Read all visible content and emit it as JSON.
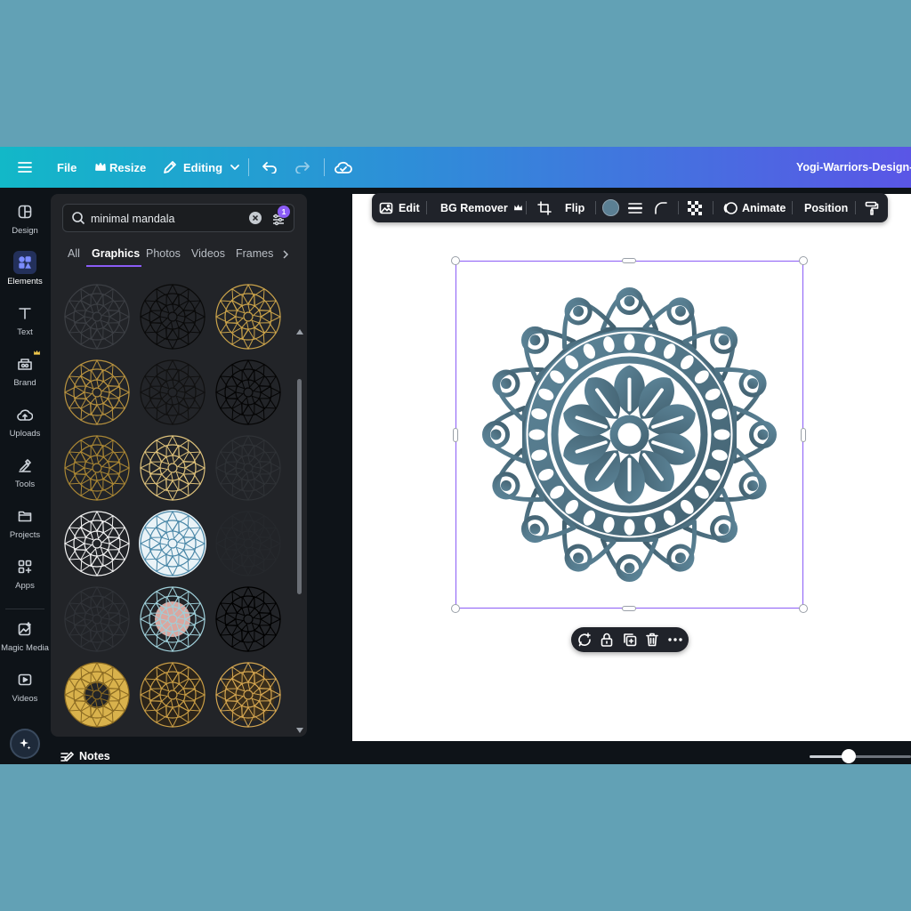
{
  "topbar": {
    "file_label": "File",
    "resize_label": "Resize",
    "editing_label": "Editing",
    "doc_title": "Yogi-Warriors-Design-Te"
  },
  "sidebar": {
    "items": [
      {
        "label": "Design",
        "icon": "layout-icon"
      },
      {
        "label": "Elements",
        "icon": "shapes-icon"
      },
      {
        "label": "Text",
        "icon": "text-icon"
      },
      {
        "label": "Brand",
        "icon": "brand-icon"
      },
      {
        "label": "Uploads",
        "icon": "upload-icon"
      },
      {
        "label": "Tools",
        "icon": "tools-icon"
      },
      {
        "label": "Projects",
        "icon": "folder-icon"
      },
      {
        "label": "Apps",
        "icon": "apps-icon"
      },
      {
        "label": "Magic Media",
        "icon": "magic-media-icon"
      },
      {
        "label": "Videos",
        "icon": "video-icon"
      }
    ]
  },
  "panel": {
    "search": {
      "value": "minimal mandala",
      "filter_count": "1"
    },
    "tabs": [
      {
        "label": "All"
      },
      {
        "label": "Graphics"
      },
      {
        "label": "Photos"
      },
      {
        "label": "Videos"
      },
      {
        "label": "Frames"
      }
    ]
  },
  "element_toolbar": {
    "edit_label": "Edit",
    "bg_remover_label": "BG Remover",
    "flip_label": "Flip",
    "animate_label": "Animate",
    "position_label": "Position",
    "color_swatch": "#5b7f93"
  },
  "bottom": {
    "notes_label": "Notes"
  },
  "colors": {
    "accent": "#8b5cf6",
    "mandala": "#4f7386",
    "gold": "#c9a24a",
    "dark": "#1a1c1f"
  }
}
